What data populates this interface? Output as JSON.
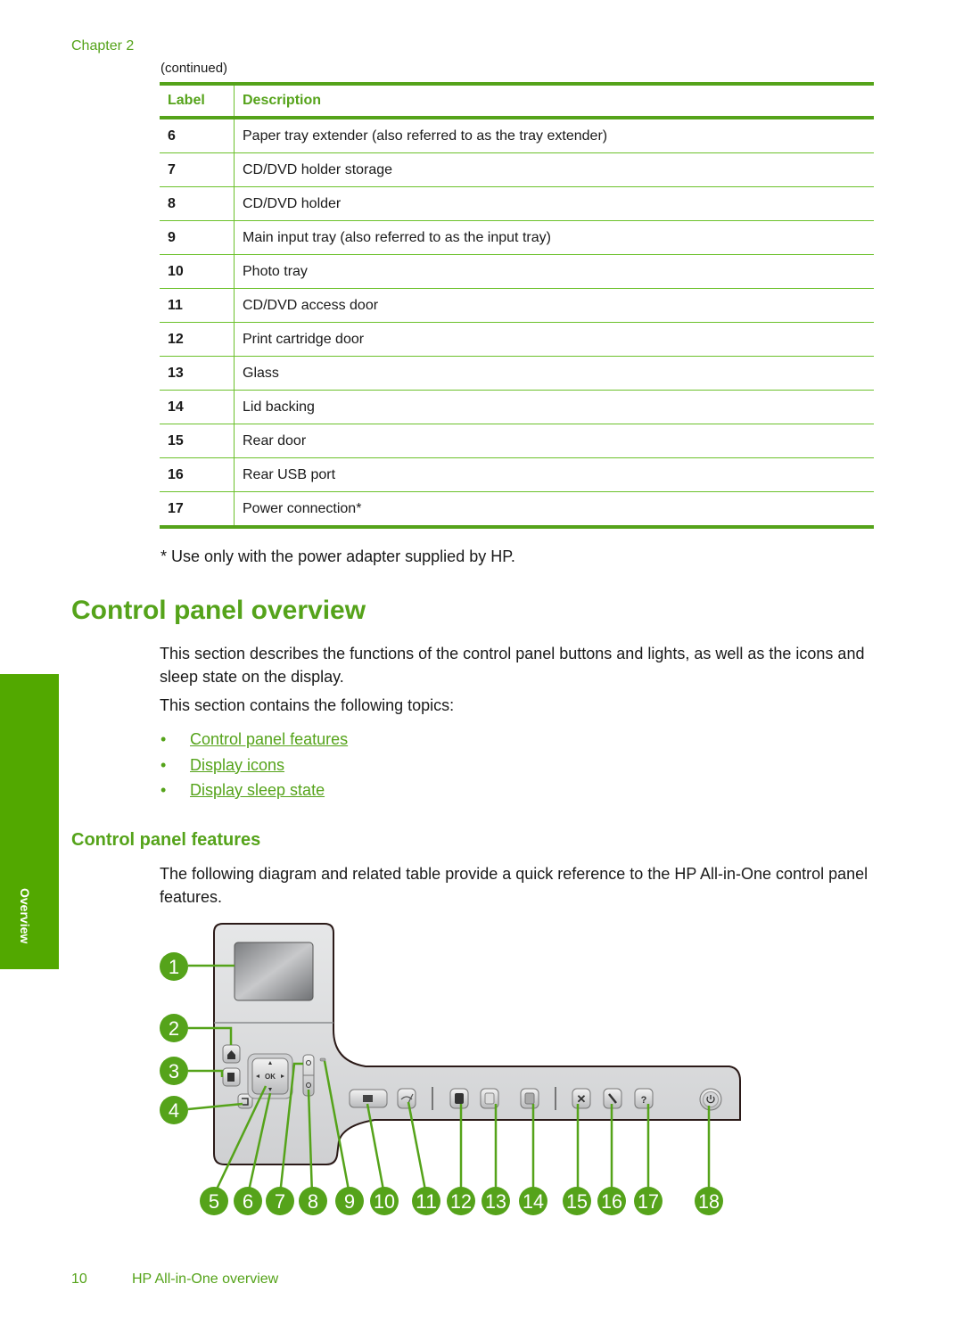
{
  "header": {
    "chapter": "Chapter 2",
    "continued": "(continued)"
  },
  "table": {
    "columns": [
      "Label",
      "Description"
    ],
    "rows": [
      {
        "label": "6",
        "description": "Paper tray extender (also referred to as the tray extender)"
      },
      {
        "label": "7",
        "description": "CD/DVD holder storage"
      },
      {
        "label": "8",
        "description": "CD/DVD holder"
      },
      {
        "label": "9",
        "description": "Main input tray (also referred to as the input tray)"
      },
      {
        "label": "10",
        "description": "Photo tray"
      },
      {
        "label": "11",
        "description": "CD/DVD access door"
      },
      {
        "label": "12",
        "description": "Print cartridge door"
      },
      {
        "label": "13",
        "description": "Glass"
      },
      {
        "label": "14",
        "description": "Lid backing"
      },
      {
        "label": "15",
        "description": "Rear door"
      },
      {
        "label": "16",
        "description": "Rear USB port"
      },
      {
        "label": "17",
        "description": "Power connection*"
      }
    ],
    "footnote": "* Use only with the power adapter supplied by HP."
  },
  "section": {
    "title": "Control panel overview",
    "intro": "This section describes the functions of the control panel buttons and lights, as well as the icons and sleep state on the display.",
    "topics_intro": "This section contains the following topics:",
    "bullet": "•",
    "topics": [
      "Control panel features",
      "Display icons",
      "Display sleep state"
    ]
  },
  "subsection": {
    "title": "Control panel features",
    "intro": "The following diagram and related table provide a quick reference to the HP All-in-One control panel features."
  },
  "diagram": {
    "callouts": [
      "1",
      "2",
      "3",
      "4",
      "5",
      "6",
      "7",
      "8",
      "9",
      "10",
      "11",
      "12",
      "13",
      "14",
      "15",
      "16",
      "17",
      "18"
    ],
    "button_glyphs": {
      "ok": "OK",
      "help": "?",
      "cancel": "✕"
    },
    "icons": [
      "display-screen",
      "home-icon",
      "menu-icon",
      "back-icon",
      "ok-button",
      "arrow-down",
      "zoom-in-icon",
      "zoom-out-icon",
      "red-eye-light",
      "print-photos-icon",
      "red-eye-removal-icon",
      "start-copy-black-icon",
      "start-copy-color-icon",
      "start-scan-icon",
      "cancel-icon",
      "setup-icon",
      "help-icon",
      "power-icon"
    ],
    "colors": {
      "callout": "#55a31a",
      "panel": "#d2d3d5",
      "outline": "#2b1a18"
    }
  },
  "side_tab": {
    "label": "Overview"
  },
  "footer": {
    "page_number": "10",
    "title": "HP All-in-One overview"
  }
}
